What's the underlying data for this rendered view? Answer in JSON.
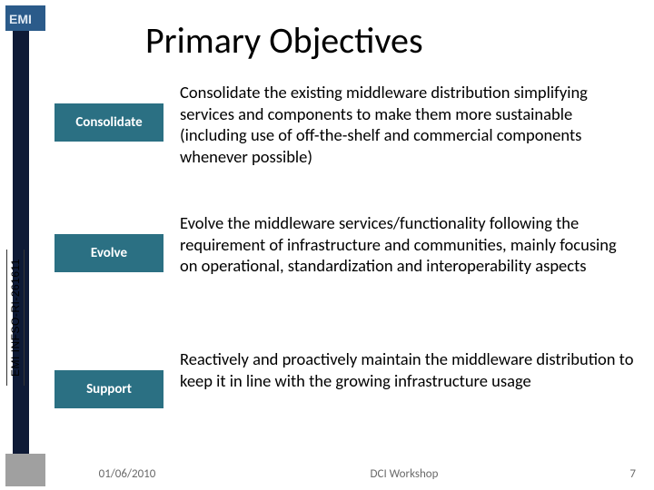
{
  "title": "Primary Objectives",
  "sideways_label": "EMI INFSO-RI-261611",
  "rows": [
    {
      "label": "Consolidate",
      "text": "Consolidate the existing middleware distribution simplifying services and components to make them more sustainable (including use of off-the-shelf and commercial components whenever possible)"
    },
    {
      "label": "Evolve",
      "text": "Evolve the middleware services/functionality following the requirement of infrastructure and communities, mainly focusing on operational, standardization and interoperability aspects"
    },
    {
      "label": "Support",
      "text": "Reactively and proactively maintain the middleware distribution to keep it in line with the growing infrastructure usage"
    }
  ],
  "footer": {
    "date": "01/06/2010",
    "mid": "DCI Workshop",
    "page": "7"
  }
}
